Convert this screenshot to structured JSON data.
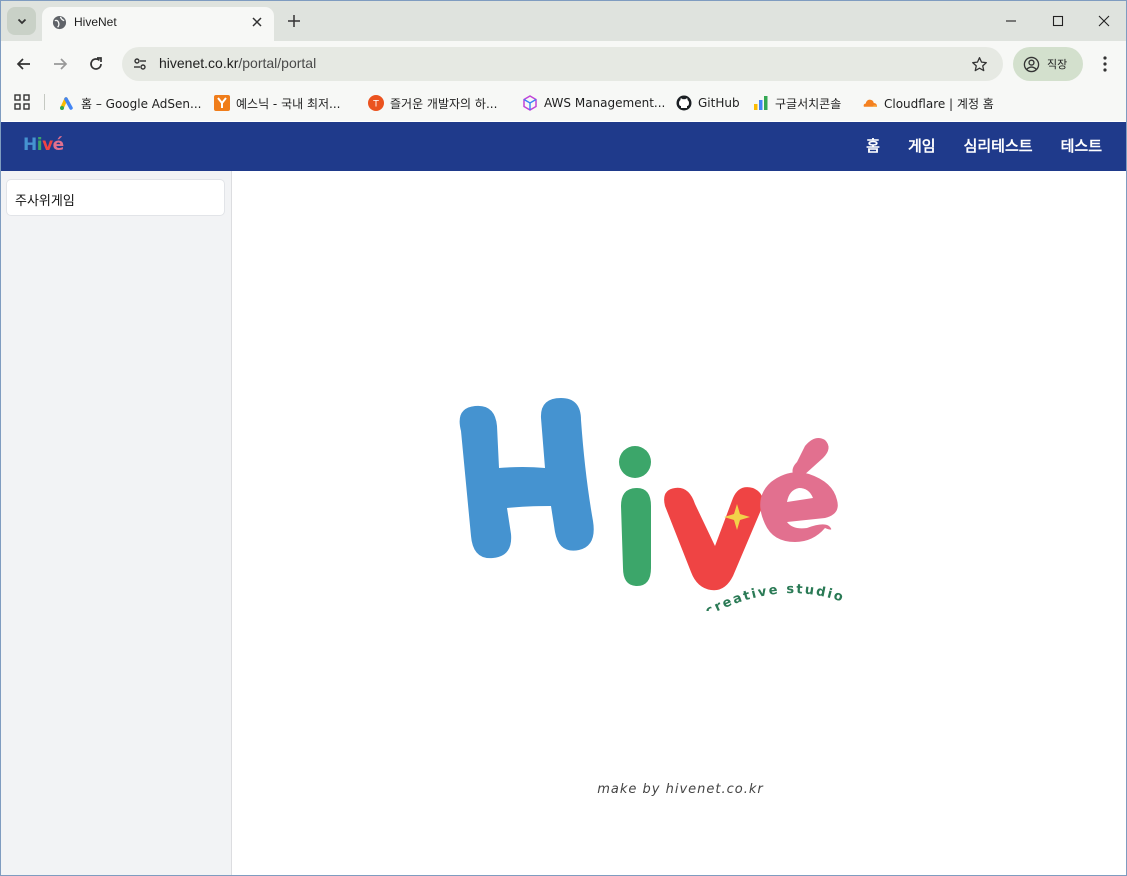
{
  "browser": {
    "tab_title": "HiveNet",
    "url_host": "hivenet.co.kr",
    "url_path": "/portal/portal",
    "profile_label": "직장"
  },
  "bookmarks": [
    {
      "label": "홈 – Google AdSen...",
      "icon": "google-ads-icon"
    },
    {
      "label": "예스닉 - 국내 최저...",
      "icon": "yesnic-icon"
    },
    {
      "label": "즐거운 개발자의 하...",
      "icon": "tistory-icon"
    },
    {
      "label": "AWS Management...",
      "icon": "aws-cube-icon"
    },
    {
      "label": "GitHub",
      "icon": "github-icon"
    },
    {
      "label": "구글서치콘솔",
      "icon": "search-console-icon"
    },
    {
      "label": "Cloudflare | 계정 홈",
      "icon": "cloudflare-icon"
    }
  ],
  "site": {
    "logo_text": "Hivé",
    "nav": [
      "홈",
      "게임",
      "심리테스트",
      "테스트"
    ],
    "sidebar_items": [
      "주사위게임"
    ],
    "hero_logo": {
      "letters": [
        "H",
        "i",
        "v",
        "é"
      ],
      "tagline": "creative studio",
      "colors": {
        "H": "#4593d0",
        "i": "#3ca66a",
        "v": "#ef4444",
        "e": "#e2708f",
        "sparkle": "#f2d24a",
        "tagline": "#2a7a55"
      }
    },
    "footer": "make by hivenet.co.kr",
    "colors": {
      "nav_bg": "#1f3a8b",
      "sidebar_bg": "#f2f3f5"
    }
  }
}
